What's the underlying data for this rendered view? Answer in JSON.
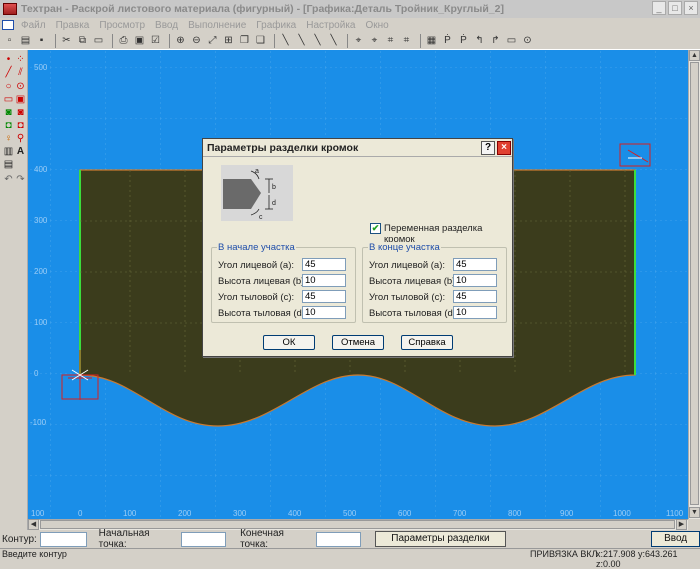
{
  "window": {
    "title": "Техтран - Раскрой листового материала (фигурный) - [Графика:Деталь Тройник_Круглый_2]",
    "controls": [
      "_",
      "□",
      "×"
    ]
  },
  "menu": [
    "Файл",
    "Правка",
    "Просмотр",
    "Ввод",
    "Выполнение",
    "Графика",
    "Настройка",
    "Окно"
  ],
  "canvas": {
    "bg_color": "#1a8ee8",
    "part_color": "#3a3c1c",
    "y_ticks": [
      "500",
      "400",
      "300",
      "200",
      "100",
      "0",
      "-100"
    ],
    "x_ticks": [
      "100",
      "0",
      "100",
      "200",
      "300",
      "400",
      "500",
      "600",
      "700",
      "800",
      "900",
      "1000",
      "1100"
    ]
  },
  "dialog": {
    "title": "Параметры разделки кромок",
    "help": "?",
    "close": "×",
    "diagram_labels": {
      "b": "b",
      "d": "d",
      "a": "a",
      "c": "c"
    },
    "variable_label": "Переменная разделка кромок",
    "variable_checked": true,
    "start_group": {
      "title": "В начале участка",
      "rows": [
        {
          "label": "Угол лицевой (a):",
          "value": "45"
        },
        {
          "label": "Высота лицевая (b):",
          "value": "10"
        },
        {
          "label": "Угол тыловой (c):",
          "value": "45"
        },
        {
          "label": "Высота тыловая (d):",
          "value": "10"
        }
      ]
    },
    "end_group": {
      "title": "В конце участка",
      "rows": [
        {
          "label": "Угол лицевой (a):",
          "value": "45"
        },
        {
          "label": "Высота лицевая (b):",
          "value": "10"
        },
        {
          "label": "Угол тыловой (c):",
          "value": "45"
        },
        {
          "label": "Высота тыловая (d):",
          "value": "10"
        }
      ]
    },
    "ok": "ОК",
    "cancel": "Отмена",
    "help_btn": "Справка"
  },
  "inputbar": {
    "contour_label": "Контур:",
    "start_label": "Начальная точка:",
    "end_label": "Конечная точка:",
    "params_button": "Параметры разделки кромок...",
    "enter_button": "Ввод"
  },
  "status": {
    "hint": "Введите контур",
    "snap": "ПРИВЯЗКА ВКЛ",
    "coords": "x:217.908 y:643.261 z:0.00"
  }
}
